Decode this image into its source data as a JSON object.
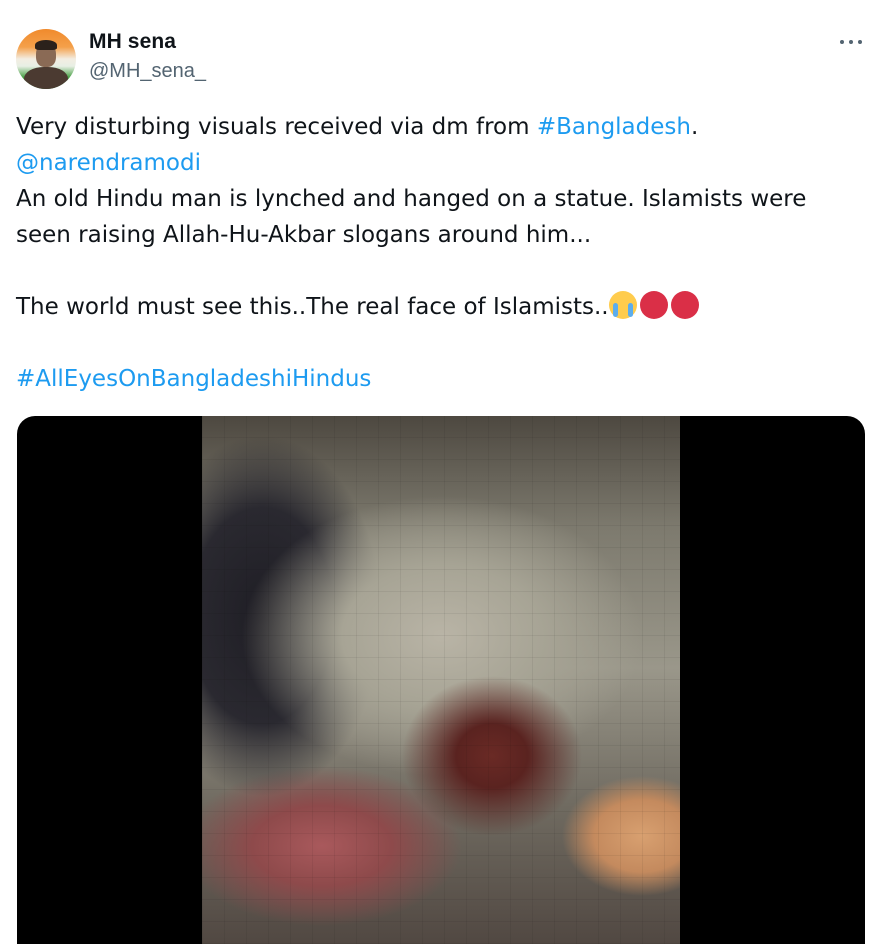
{
  "author": {
    "display_name": "MH sena",
    "handle": "@MH_sena_"
  },
  "more_menu": {
    "icon": "more-horizontal-icon"
  },
  "tweet": {
    "line1_prefix": "Very disturbing visuals received via dm from ",
    "line1_hashtag": "#Bangladesh",
    "line1_suffix": ".",
    "mention": "@narendramodi",
    "line3": "An old Hindu man is lynched and hanged on a statue. Islamists were",
    "line4": "seen raising Allah-Hu-Akbar slogans around him...",
    "line6": "The world must see this..The real face of Islamists..",
    "emojis": [
      "loudly-crying-face",
      "pouting-face",
      "pouting-face"
    ],
    "hashtag2": "#AllEyesOnBangladeshiHindus"
  },
  "colors": {
    "link": "#1d9bf0",
    "text": "#0f1419",
    "secondary": "#536471"
  },
  "media": {
    "type": "video-thumbnail",
    "blurred": true
  }
}
